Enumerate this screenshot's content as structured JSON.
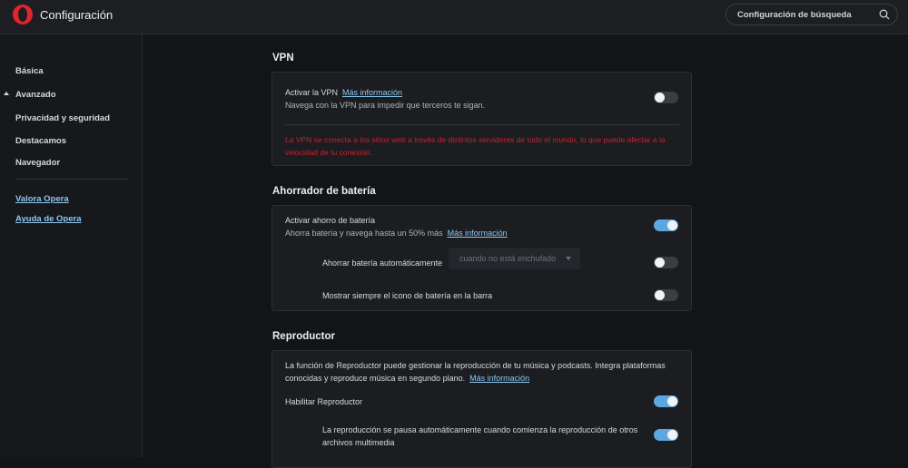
{
  "header": {
    "title": "Configuración",
    "search_placeholder": "Configuración de búsqueda",
    "icons": {
      "logo": "opera-logo",
      "search": "search-icon"
    }
  },
  "sidebar": {
    "items": [
      {
        "label": "Básica"
      },
      {
        "label": "Avanzado",
        "expanded": true
      },
      {
        "label": "Privacidad y seguridad"
      },
      {
        "label": "Destacamos"
      },
      {
        "label": "Navegador"
      }
    ],
    "links": [
      {
        "label": "Valora Opera"
      },
      {
        "label": "Ayuda de Opera"
      }
    ]
  },
  "vpn": {
    "title": "VPN",
    "enable_label": "Activar la VPN",
    "more_info": "Más información",
    "description": "Navega con la VPN para impedir que terceros te sigan.",
    "enabled": false,
    "warning": "La VPN se conecta a los sitios web a través de distintos servidores de todo el mundo, lo que puede afectar a la velocidad de tu conexión."
  },
  "battery": {
    "title": "Ahorrador de batería",
    "enable_label": "Activar ahorro de batería",
    "description": "Ahorra batería y navega hasta un 50% más",
    "more_info": "Más información",
    "enabled": true,
    "auto_label": "Ahorrar batería automáticamente",
    "auto_option": "cuando no está enchufado",
    "auto_enabled": false,
    "icon_label": "Mostrar siempre el icono de batería en la barra",
    "icon_enabled": false
  },
  "player": {
    "title": "Reproductor",
    "description_line1": "La función de Reproductor puede gestionar la reproducción de tu música y podcasts. Integra plataformas",
    "description_line2": "conocidas y reproduce música en segundo plano.",
    "more_info": "Más información",
    "enable_label": "Habilitar Reproductor",
    "enabled": true,
    "autopause_line1": "La reproducción se pausa automáticamente cuando comienza la reproducción de otros",
    "autopause_line2": "archivos multimedia",
    "autopause_enabled": true
  },
  "colors": {
    "accent": "#5da7e0",
    "link": "#8fc7f0",
    "warning": "#c8222b",
    "brand": "#e3232f"
  }
}
